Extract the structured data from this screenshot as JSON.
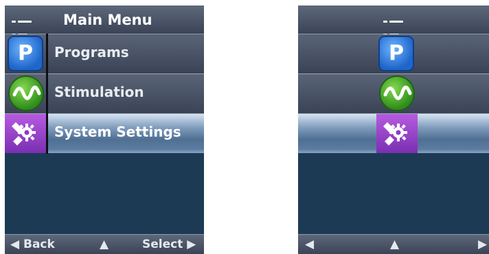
{
  "screen_a": {
    "title": "Main Menu",
    "items": [
      {
        "label": "Programs",
        "icon": "programs-p-icon"
      },
      {
        "label": "Stimulation",
        "icon": "stimulation-wave-icon"
      },
      {
        "label": "System Settings",
        "icon": "system-settings-gear-icon",
        "selected": true
      }
    ],
    "bottom": {
      "back_glyph": "◀",
      "back_label": "Back",
      "up_glyph": "▲",
      "select_label": "Select",
      "select_glyph": "▶"
    }
  },
  "screen_b": {
    "items": [
      {
        "icon": "programs-p-icon"
      },
      {
        "icon": "stimulation-wave-icon"
      },
      {
        "icon": "system-settings-gear-icon",
        "selected": true
      }
    ],
    "bottom": {
      "left_glyph": "◀",
      "up_glyph": "▲",
      "right_glyph": "▶"
    }
  },
  "icons": {
    "programs_letter": "P"
  },
  "colors": {
    "selected_row": "#6f8eb1",
    "background": "#1d3a55",
    "programs_blue": "#1f66c9",
    "stimulation_green": "#3f9e26",
    "settings_purple": "#8d3cc7"
  }
}
